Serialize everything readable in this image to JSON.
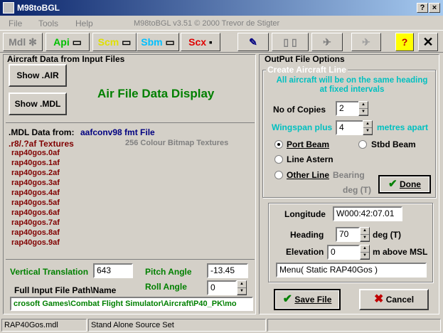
{
  "window": {
    "title": "M98toBGL"
  },
  "menu": {
    "file": "File",
    "tools": "Tools",
    "help": "Help",
    "info": "M98toBGL  v3.51  © 2000  Trevor de Stigter"
  },
  "toolbar": {
    "mdl": "Mdl",
    "api": "Api",
    "scm": "Scm",
    "sbm": "Sbm",
    "scx": "Scx",
    "help": "?",
    "close": "✕"
  },
  "left": {
    "aircraft_header": "Aircraft Data from Input Files",
    "show_air": "Show .AIR",
    "show_mdl": "Show .MDL",
    "display_title": "Air File Data Display",
    "mdl_from_label": ".MDL Data from:",
    "mdl_from_value": "aafconv98 fmt File",
    "textures_label": ".r8/.?af Textures",
    "bitmap_label": "256 Colour Bitmap Textures",
    "textures": [
      "rap40gos.0af",
      "rap40gos.1af",
      "rap40gos.2af",
      "rap40gos.3af",
      "rap40gos.4af",
      "rap40gos.5af",
      "rap40gos.6af",
      "rap40gos.7af",
      "rap40gos.8af",
      "rap40gos.9af"
    ],
    "vertical_label": "Vertical Translation",
    "vertical_value": "643",
    "pitch_label": "Pitch Angle",
    "pitch_value": "-13.45",
    "roll_label": "Roll Angle",
    "roll_value": "0",
    "path_label": "Full Input File Path\\Name",
    "path_value": "crosoft Games\\Combat Flight Simulator\\Aircraft\\P40_PK\\mo"
  },
  "right": {
    "output_header": "OutPut File Options",
    "create_header": "Create Aircraft Line",
    "note": "All aircraft will be on the same heading at fixed intervals",
    "copies_label": "No of Copies",
    "copies_value": "2",
    "wingspan_label": "Wingspan plus",
    "wingspan_value": "4",
    "metres_label": "metres apart",
    "port_beam": "Port Beam",
    "stbd_beam": "Stbd Beam",
    "line_astern": "Line Astern",
    "other_line": "Other Line",
    "bearing_label": "Bearing",
    "deg_t": "deg (T)",
    "done": "Done",
    "longitude_label": "Longitude",
    "longitude_value": "W000:42:07.01",
    "heading_label": "Heading",
    "heading_value": "70",
    "heading_unit": "deg (T)",
    "elevation_label": "Elevation",
    "elevation_value": "0",
    "elevation_unit": "m above MSL",
    "menu_value": "Menu( Static RAP40Gos )",
    "save_file": "Save File",
    "cancel": "Cancel"
  },
  "status": {
    "file": "RAP40Gos.mdl",
    "mode": "Stand Alone Source Set"
  }
}
